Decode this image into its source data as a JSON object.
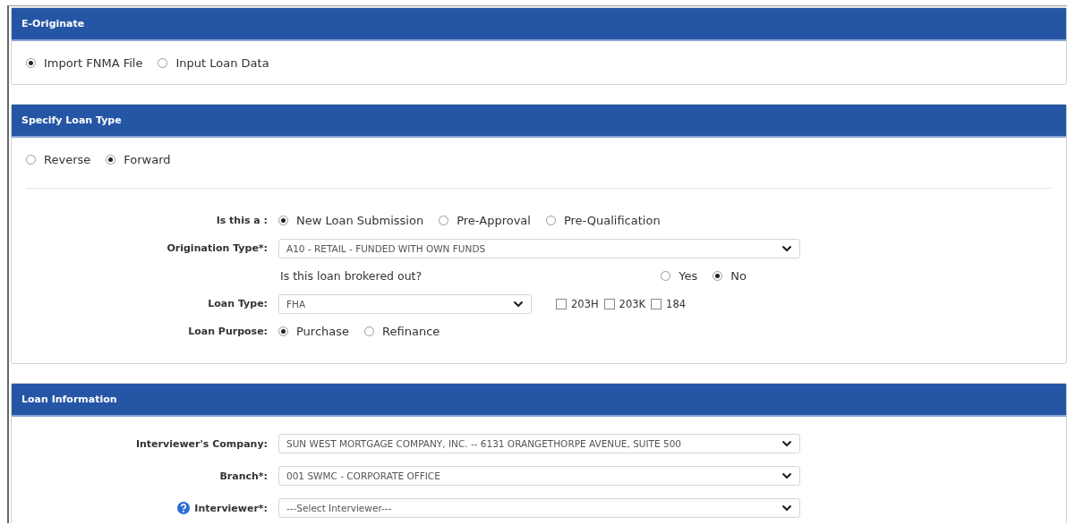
{
  "panels": [
    {
      "title": "E-Originate",
      "options": [
        {
          "label": "Import FNMA File",
          "selected": true
        },
        {
          "label": "Input Loan Data",
          "selected": false
        }
      ]
    },
    {
      "title": "Specify Loan Type",
      "options": [
        {
          "label": "Reverse",
          "selected": false
        },
        {
          "label": "Forward",
          "selected": true
        }
      ],
      "fields": [
        {
          "kind": "radios",
          "label": "Is this a :",
          "options": [
            {
              "label": "New Loan Submission",
              "selected": true
            },
            {
              "label": "Pre-Approval",
              "selected": false
            },
            {
              "label": "Pre-Qualification",
              "selected": false
            }
          ]
        },
        {
          "kind": "select",
          "label": "Origination Type*:",
          "value": "A10 - RETAIL - FUNDED WITH OWN FUNDS"
        },
        {
          "kind": "question",
          "text": "Is this loan brokered out?",
          "options": [
            {
              "label": "Yes",
              "selected": false
            },
            {
              "label": "No",
              "selected": true
            }
          ]
        },
        {
          "kind": "narrowselect",
          "label": "Loan Type:",
          "value": "FHA",
          "checkboxes": [
            {
              "label": "203H",
              "checked": false
            },
            {
              "label": "203K",
              "checked": false
            },
            {
              "label": "184",
              "checked": false
            }
          ]
        },
        {
          "kind": "radios",
          "label": "Loan Purpose:",
          "options": [
            {
              "label": "Purchase",
              "selected": true
            },
            {
              "label": "Refinance",
              "selected": false
            }
          ]
        }
      ]
    },
    {
      "title": "Loan Information",
      "fields": [
        {
          "kind": "select",
          "label": "Interviewer's Company:",
          "value": "SUN WEST MORTGAGE COMPANY, INC. -- 6131 ORANGETHORPE AVENUE, SUITE 500"
        },
        {
          "kind": "select",
          "label": "Branch*:",
          "value": "001 SWMC - CORPORATE OFFICE"
        },
        {
          "kind": "select",
          "label": "Interviewer*:",
          "value": "---Select Interviewer---",
          "help": true
        }
      ]
    }
  ]
}
